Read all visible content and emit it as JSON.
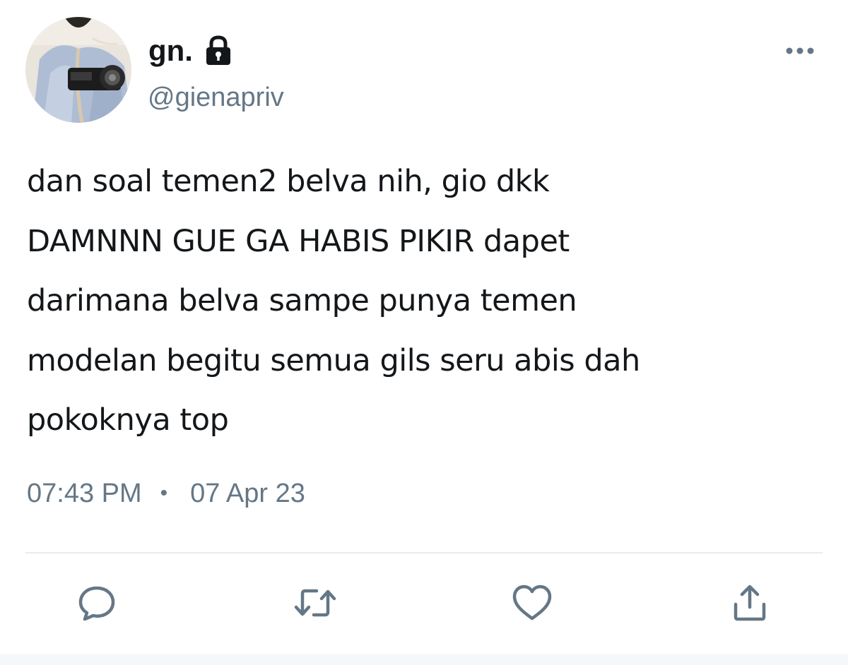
{
  "user": {
    "display_name": "gn.",
    "handle": "@gienapriv",
    "protected_icon": "lock-icon",
    "avatar_icon": "profile-photo"
  },
  "tweet": {
    "text": "dan soal temen2 belva nih, gio dkk\nDAMNNN GUE GA HABIS PIKIR dapet\ndarimana belva sampe punya temen\nmodelan begitu semua gils seru abis dah\npokoknya top",
    "time": "07:43 PM",
    "separator": "•",
    "date": "07 Apr 23"
  },
  "actions": [
    {
      "name": "reply",
      "icon": "speech-bubble-icon"
    },
    {
      "name": "retweet",
      "icon": "retweet-arrows-icon"
    },
    {
      "name": "like",
      "icon": "heart-icon"
    },
    {
      "name": "share",
      "icon": "share-upload-icon"
    }
  ],
  "colors": {
    "text_primary": "#14171a",
    "text_secondary": "#657786",
    "divider": "#e6ecf0",
    "background": "#ffffff"
  }
}
